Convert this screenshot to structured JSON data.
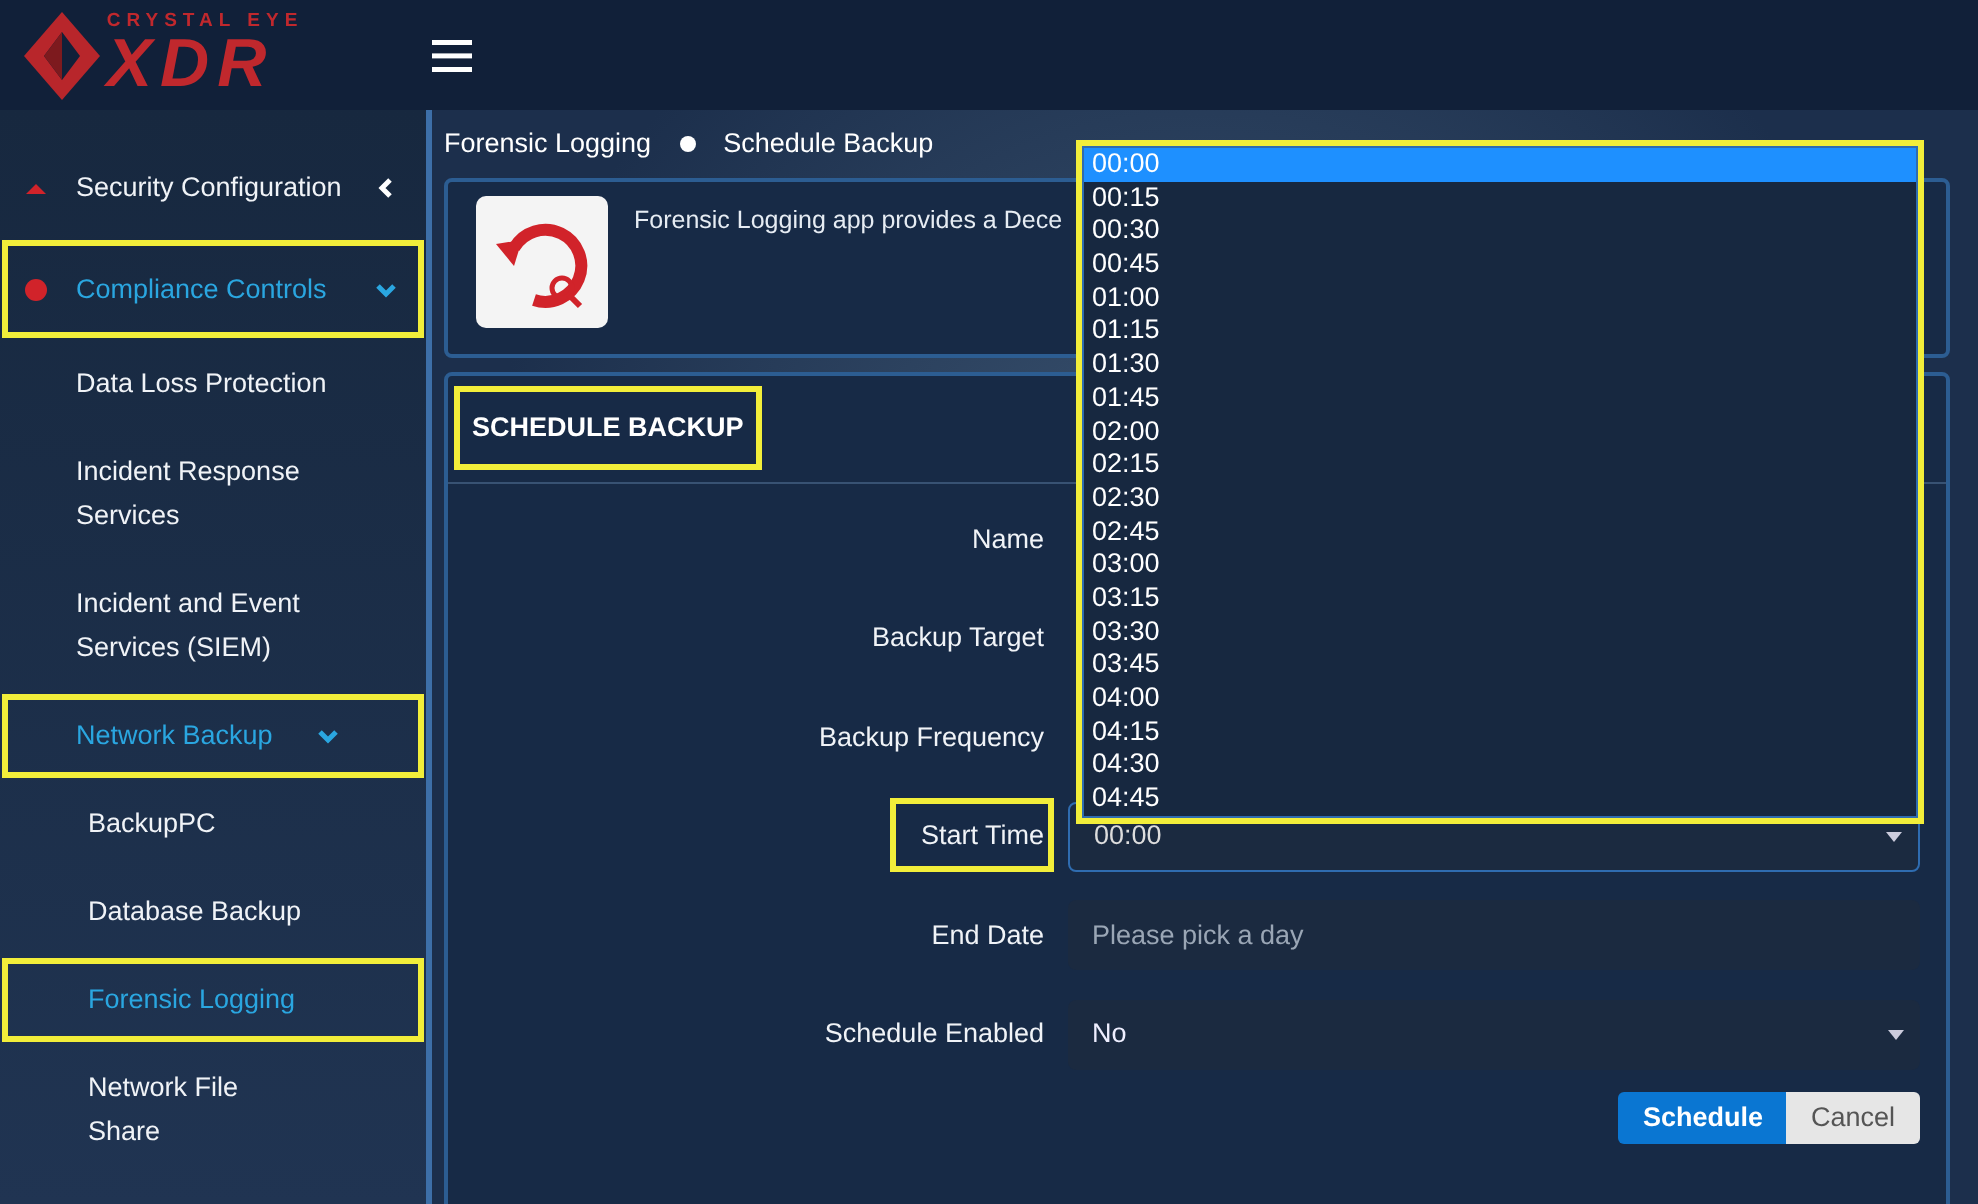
{
  "header": {
    "logo_top": "CRYSTAL EYE",
    "logo_main": "XDR"
  },
  "sidebar": {
    "items": [
      {
        "label": "Security Configuration",
        "expanded": false,
        "selected": false,
        "highlighted": false
      },
      {
        "label": "Compliance Controls",
        "expanded": true,
        "selected": true,
        "highlighted": true,
        "children": [
          {
            "label": "Data Loss Protection",
            "selected": false,
            "highlighted": false
          },
          {
            "label": "Incident Response Services",
            "selected": false,
            "highlighted": false
          },
          {
            "label": "Incident and Event Services (SIEM)",
            "selected": false,
            "highlighted": false
          },
          {
            "label": "Network Backup",
            "expanded": true,
            "selected": true,
            "highlighted": true,
            "children": [
              {
                "label": "BackupPC",
                "selected": false,
                "highlighted": false
              },
              {
                "label": "Database Backup",
                "selected": false,
                "highlighted": false
              },
              {
                "label": "Forensic Logging",
                "selected": true,
                "highlighted": true
              },
              {
                "label": "Network File Share",
                "selected": false,
                "highlighted": false
              }
            ]
          }
        ]
      }
    ]
  },
  "breadcrumb": [
    "Forensic Logging",
    "Schedule Backup"
  ],
  "app_info": {
    "description": "Forensic Logging app provides a Dece"
  },
  "form": {
    "title": "SCHEDULE BACKUP",
    "highlighted": true,
    "fields": [
      {
        "label": "Name",
        "kind": "covered",
        "highlighted": false
      },
      {
        "label": "Backup Target",
        "kind": "covered",
        "highlighted": false
      },
      {
        "label": "Backup Frequency",
        "kind": "covered",
        "highlighted": false
      },
      {
        "label": "Start Time",
        "kind": "select",
        "value": "00:00",
        "highlighted": true
      },
      {
        "label": "End Date",
        "kind": "date",
        "placeholder": "Please pick a day",
        "highlighted": false
      },
      {
        "label": "Schedule Enabled",
        "kind": "select",
        "value": "No",
        "highlighted": false
      }
    ],
    "buttons": [
      {
        "label": "Schedule",
        "kind": "primary"
      },
      {
        "label": "Cancel",
        "kind": "secondary"
      }
    ]
  },
  "time_dropdown": {
    "highlighted": true,
    "options": [
      {
        "label": "00:00",
        "selected": true
      },
      {
        "label": "00:15",
        "selected": false
      },
      {
        "label": "00:30",
        "selected": false
      },
      {
        "label": "00:45",
        "selected": false
      },
      {
        "label": "01:00",
        "selected": false
      },
      {
        "label": "01:15",
        "selected": false
      },
      {
        "label": "01:30",
        "selected": false
      },
      {
        "label": "01:45",
        "selected": false
      },
      {
        "label": "02:00",
        "selected": false
      },
      {
        "label": "02:15",
        "selected": false
      },
      {
        "label": "02:30",
        "selected": false
      },
      {
        "label": "02:45",
        "selected": false
      },
      {
        "label": "03:00",
        "selected": false
      },
      {
        "label": "03:15",
        "selected": false
      },
      {
        "label": "03:30",
        "selected": false
      },
      {
        "label": "03:45",
        "selected": false
      },
      {
        "label": "04:00",
        "selected": false
      },
      {
        "label": "04:15",
        "selected": false
      },
      {
        "label": "04:30",
        "selected": false
      },
      {
        "label": "04:45",
        "selected": false
      }
    ]
  }
}
